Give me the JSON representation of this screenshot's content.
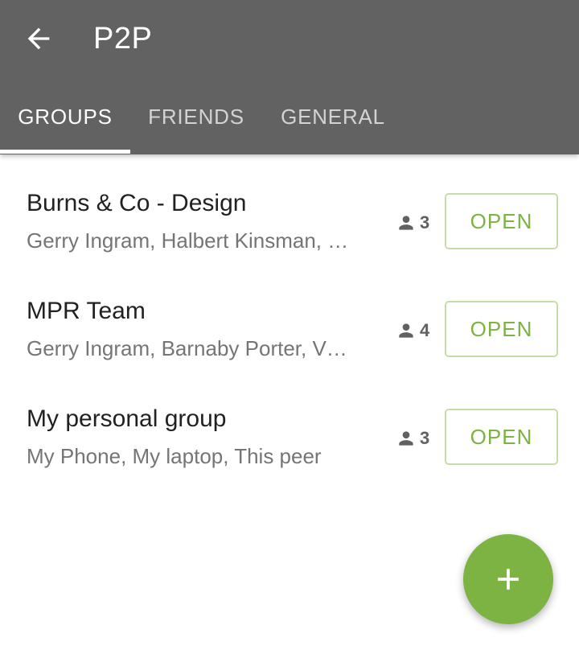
{
  "appbar": {
    "title": "P2P",
    "back_icon": "arrow-back-icon",
    "background": "#626262"
  },
  "tabs": [
    {
      "label": "GROUPS",
      "active": true
    },
    {
      "label": "FRIENDS",
      "active": false
    },
    {
      "label": "GENERAL",
      "active": false
    }
  ],
  "groups": [
    {
      "name": "Burns & Co - Design",
      "members": "Gerry Ingram, Halbert Kinsman, …",
      "count": "3",
      "action": "OPEN"
    },
    {
      "name": "MPR Team",
      "members": "Gerry Ingram, Barnaby Porter, V…",
      "count": "4",
      "action": "OPEN"
    },
    {
      "name": "My personal group",
      "members": "My Phone, My laptop, This peer",
      "count": "3",
      "action": "OPEN"
    }
  ],
  "fab": {
    "icon": "plus-icon"
  },
  "colors": {
    "accent": "#7cb342",
    "button_border": "#c8dca9"
  }
}
